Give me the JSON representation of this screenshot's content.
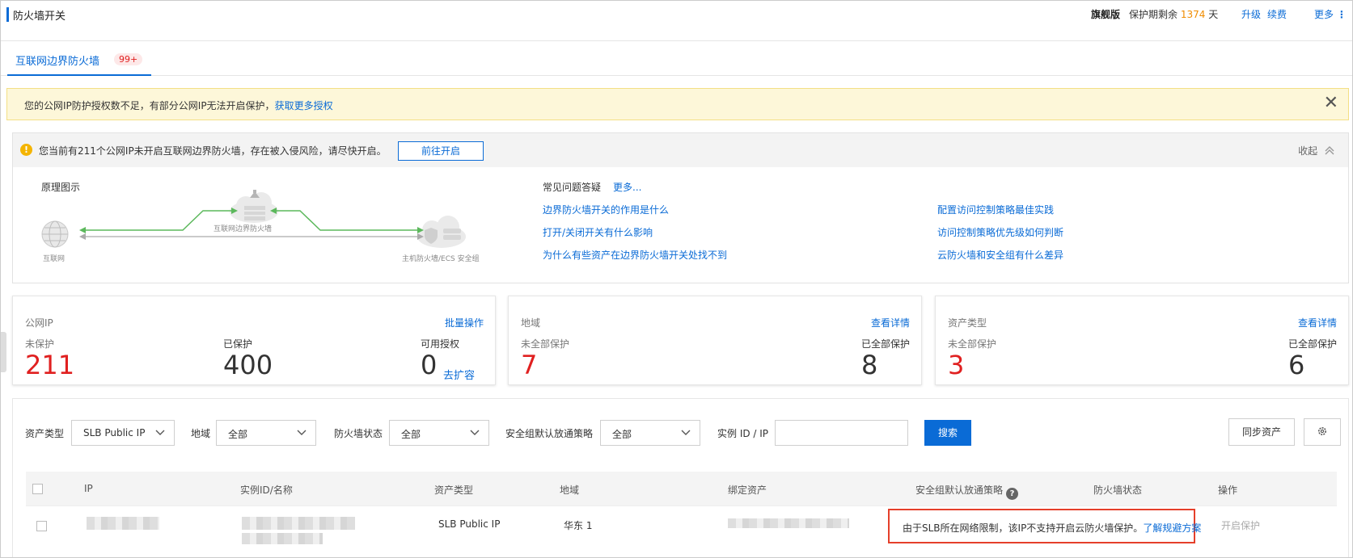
{
  "header": {
    "title": "防火墙开关",
    "edition": "旗舰版",
    "protect_prefix": "保护期剩余",
    "protect_days": "1374",
    "protect_suffix": "天",
    "upgrade": "升级",
    "renew": "续费",
    "more": "更多"
  },
  "tabs": [
    {
      "label": "互联网边界防火墙",
      "badge": "99+"
    }
  ],
  "warning": {
    "text": "您的公网IP防护授权数不足，有部分公网IP无法开启保护，",
    "link": "获取更多授权"
  },
  "info": {
    "message": "您当前有211个公网IP未开启互联网边界防火墙，存在被入侵风险，请尽快开启。",
    "goto_button": "前往开启",
    "collapse": "收起",
    "diagram": {
      "title": "原理图示",
      "internet": "互联网",
      "firewall": "互联网边界防火墙",
      "host": "主机防火墙/ECS 安全组"
    },
    "faq": {
      "title": "常见问题答疑",
      "more": "更多...",
      "col1": [
        "边界防火墙开关的作用是什么",
        "打开/关闭开关有什么影响",
        "为什么有些资产在边界防火墙开关处找不到"
      ],
      "col2": [
        "配置访问控制策略最佳实践",
        "访问控制策略优先级如何判断",
        "云防火墙和安全组有什么差异"
      ]
    }
  },
  "cards": {
    "ip": {
      "title": "公网IP",
      "action": "批量操作",
      "unprotected_label": "未保护",
      "unprotected": "211",
      "protected_label": "已保护",
      "protected": "400",
      "available_label": "可用授权",
      "available": "0",
      "expand": "去扩容"
    },
    "region": {
      "title": "地域",
      "action": "查看详情",
      "partial_label": "未全部保护",
      "partial": "7",
      "all_label": "已全部保护",
      "all": "8"
    },
    "asset": {
      "title": "资产类型",
      "action": "查看详情",
      "partial_label": "未全部保护",
      "partial": "3",
      "all_label": "已全部保护",
      "all": "6"
    }
  },
  "filters": {
    "asset_type_label": "资产类型",
    "asset_type_value": "SLB Public IP",
    "region_label": "地域",
    "region_value": "全部",
    "fw_status_label": "防火墙状态",
    "fw_status_value": "全部",
    "sg_policy_label": "安全组默认放通策略",
    "sg_policy_value": "全部",
    "instance_label": "实例 ID / IP",
    "instance_value": "",
    "search": "搜索",
    "sync": "同步资产"
  },
  "table": {
    "columns": [
      "IP",
      "实例ID/名称",
      "资产类型",
      "地域",
      "绑定资产",
      "安全组默认放通策略",
      "防火墙状态",
      "操作"
    ],
    "rows": [
      {
        "asset_type": "SLB Public IP",
        "region": "华东 1",
        "action": "开启保护"
      }
    ]
  },
  "tooltip": {
    "text": "由于SLB所在网络限制，该IP不支持开启云防火墙保护。",
    "link": "了解规避方案"
  }
}
